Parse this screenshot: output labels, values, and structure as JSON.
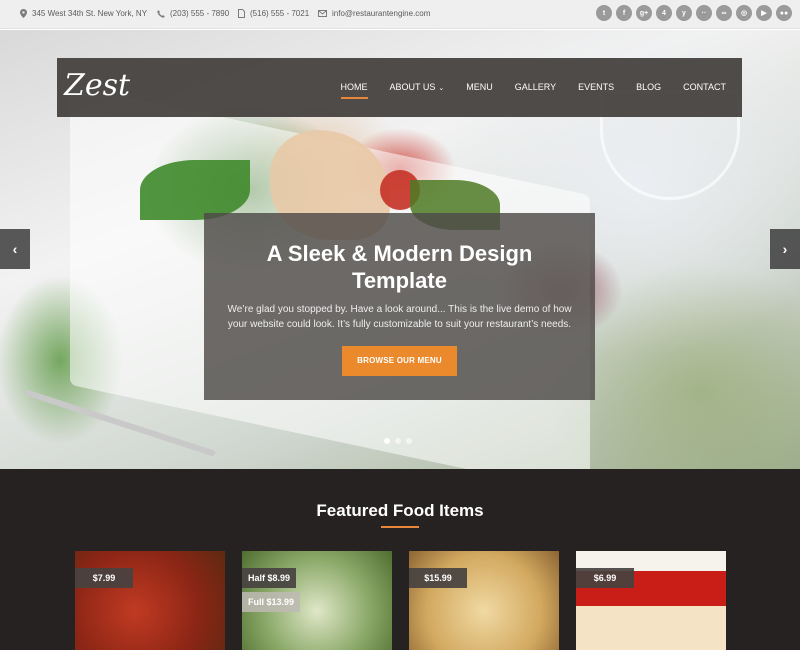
{
  "topbar": {
    "address": "345 West 34th St. New York, NY",
    "phone": "(203) 555 - 7890",
    "fax": "(516) 555 - 7021",
    "email": "info@restaurantengine.com",
    "social_icons": [
      "twitter-icon",
      "facebook-icon",
      "google-plus-icon",
      "foursquare-icon",
      "yelp-icon",
      "flickr-icon",
      "tripadvisor-icon",
      "instagram-icon",
      "youtube-icon",
      "flickr-dots-icon"
    ],
    "social_glyphs": [
      "t",
      "f",
      "g+",
      "4",
      "y",
      "··",
      "∞",
      "◎",
      "▶",
      "●●"
    ]
  },
  "nav": {
    "logo": "Zest",
    "items": [
      "HOME",
      "ABOUT US",
      "MENU",
      "GALLERY",
      "EVENTS",
      "BLOG",
      "CONTACT"
    ],
    "active_index": 0,
    "accent": "#e8863a"
  },
  "hero": {
    "title": "A Sleek & Modern Design Template",
    "text": "We’re glad you stopped by.  Have a look around...  This is the live demo of how your website could look.  It’s fully customizable to suit your restaurant’s needs.",
    "button": "BROWSE OUR MENU",
    "button_color": "#ea8a2d",
    "prev_arrow": "‹",
    "next_arrow": "›",
    "slide_count": 3,
    "active_slide": 1
  },
  "featured": {
    "title": "Featured Food Items",
    "items": [
      {
        "prices": [
          "$7.99"
        ]
      },
      {
        "prices": [
          "Half $8.99",
          "Full $13.99"
        ]
      },
      {
        "prices": [
          "$15.99"
        ]
      },
      {
        "prices": [
          "$6.99"
        ]
      }
    ]
  }
}
